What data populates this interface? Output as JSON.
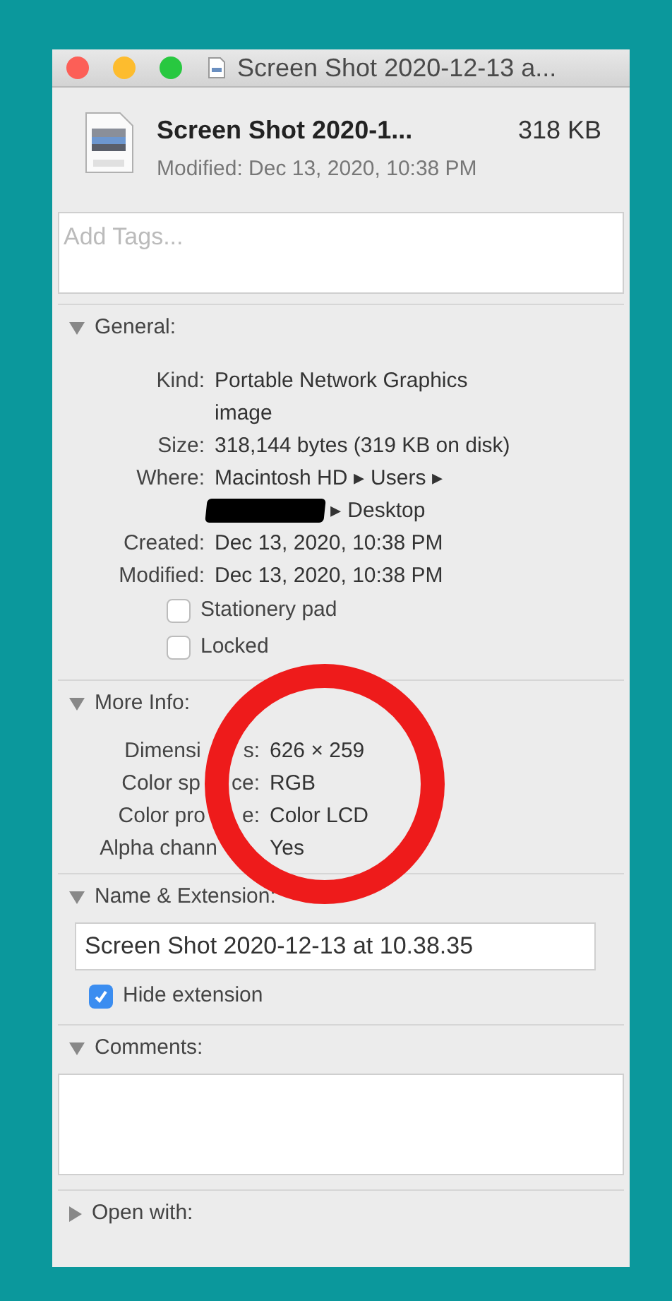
{
  "window": {
    "title": "Screen Shot 2020-12-13 a..."
  },
  "header": {
    "name": "Screen Shot 2020-1...",
    "size": "318 KB",
    "modified": "Modified: Dec 13, 2020, 10:38 PM"
  },
  "tags": {
    "placeholder": "Add Tags..."
  },
  "sections": [
    {
      "kind": "info",
      "title": "General:",
      "expanded": true,
      "rows": [
        {
          "label_parts": [
            "Kind:"
          ],
          "lines": [
            "Portable Network Graphics",
            "image"
          ]
        },
        {
          "label_parts": [
            "Size:"
          ],
          "lines": [
            "318,144 bytes (319 KB on disk)"
          ]
        },
        {
          "label_parts": [
            "Where:"
          ],
          "lines": [
            "Macintosh HD ▸ Users ▸",
            "▸ Desktop"
          ],
          "redacted": true
        },
        {
          "label_parts": [
            "Created:"
          ],
          "lines": [
            "Dec 13, 2020, 10:38 PM"
          ]
        },
        {
          "label_parts": [
            "Modified:"
          ],
          "lines": [
            "Dec 13, 2020, 10:38 PM"
          ]
        }
      ],
      "checkboxes": [
        {
          "label": "Stationery pad",
          "checked": false
        },
        {
          "label": "Locked",
          "checked": false
        }
      ]
    },
    {
      "kind": "info",
      "title": "More Info:",
      "expanded": true,
      "rows": [
        {
          "label_parts": [
            "Dimensi",
            "s:"
          ],
          "lines": [
            "626 × 259"
          ]
        },
        {
          "label_parts": [
            "Color sp",
            "ce:"
          ],
          "lines": [
            "RGB"
          ]
        },
        {
          "label_parts": [
            "Color pro",
            "e:"
          ],
          "lines": [
            "Color LCD"
          ]
        },
        {
          "label_parts": [
            "Alpha chann"
          ],
          "lines": [
            "Yes"
          ]
        }
      ]
    },
    {
      "kind": "name",
      "title": "Name & Extension:",
      "expanded": true,
      "value": "Screen Shot 2020-12-13 at 10.38.35",
      "checkboxes": [
        {
          "label": "Hide extension",
          "checked": true
        }
      ]
    },
    {
      "kind": "comments",
      "title": "Comments:",
      "expanded": true
    },
    {
      "kind": "collapsed",
      "title": "Open with:",
      "expanded": false
    }
  ]
}
